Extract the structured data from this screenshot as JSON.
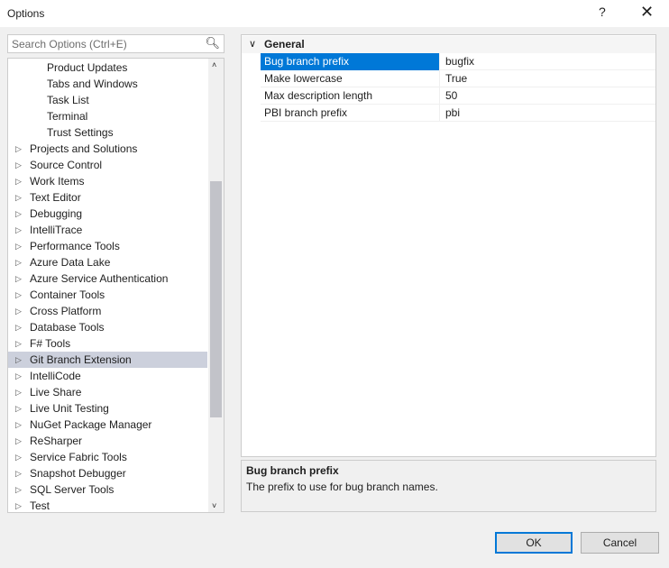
{
  "window": {
    "title": "Options",
    "help": "?",
    "close": "✕"
  },
  "search": {
    "placeholder": "Search Options (Ctrl+E)",
    "icon": "search-icon"
  },
  "tree": {
    "items": [
      {
        "label": "Product Updates",
        "child": true
      },
      {
        "label": "Tabs and Windows",
        "child": true
      },
      {
        "label": "Task List",
        "child": true
      },
      {
        "label": "Terminal",
        "child": true
      },
      {
        "label": "Trust Settings",
        "child": true
      },
      {
        "label": "Projects and Solutions"
      },
      {
        "label": "Source Control"
      },
      {
        "label": "Work Items"
      },
      {
        "label": "Text Editor"
      },
      {
        "label": "Debugging"
      },
      {
        "label": "IntelliTrace"
      },
      {
        "label": "Performance Tools"
      },
      {
        "label": "Azure Data Lake"
      },
      {
        "label": "Azure Service Authentication"
      },
      {
        "label": "Container Tools"
      },
      {
        "label": "Cross Platform"
      },
      {
        "label": "Database Tools"
      },
      {
        "label": "F# Tools"
      },
      {
        "label": "Git Branch Extension",
        "selected": true
      },
      {
        "label": "IntelliCode"
      },
      {
        "label": "Live Share"
      },
      {
        "label": "Live Unit Testing"
      },
      {
        "label": "NuGet Package Manager"
      },
      {
        "label": "ReSharper"
      },
      {
        "label": "Service Fabric Tools"
      },
      {
        "label": "Snapshot Debugger"
      },
      {
        "label": "SQL Server Tools"
      },
      {
        "label": "Test"
      }
    ]
  },
  "grid": {
    "category": "General",
    "rows": [
      {
        "name": "Bug branch prefix",
        "value": "bugfix",
        "selected": true
      },
      {
        "name": "Make lowercase",
        "value": "True"
      },
      {
        "name": "Max description length",
        "value": "50"
      },
      {
        "name": "PBI branch prefix",
        "value": "pbi"
      }
    ]
  },
  "description": {
    "title": "Bug branch prefix",
    "text": "The prefix to use for bug branch names."
  },
  "buttons": {
    "ok": "OK",
    "cancel": "Cancel"
  },
  "colors": {
    "accent": "#0078d7",
    "tree_selected": "#ccd0dc"
  }
}
